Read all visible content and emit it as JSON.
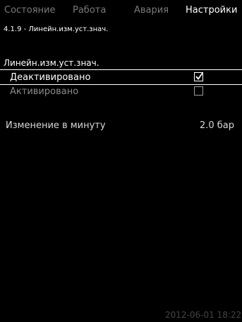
{
  "tabs": [
    {
      "label": "Состояние"
    },
    {
      "label": "Работа"
    },
    {
      "label": "Авария"
    },
    {
      "label": "Настройки"
    }
  ],
  "breadcrumb": "4.1.9 - Линейн.изм.уст.знач.",
  "section_title": "Линейн.изм.уст.знач.",
  "options": [
    {
      "label": "Деактивировано",
      "checked": true
    },
    {
      "label": "Активировано",
      "checked": false
    }
  ],
  "parameter": {
    "label": "Изменение в минуту",
    "value": "2.0 бар"
  },
  "timestamp": "2012-06-01 18:22",
  "colors": {
    "background": "#000000",
    "text": "#ffffff",
    "inactive_text": "#7a7a7a",
    "dim_timestamp": "#444444"
  }
}
